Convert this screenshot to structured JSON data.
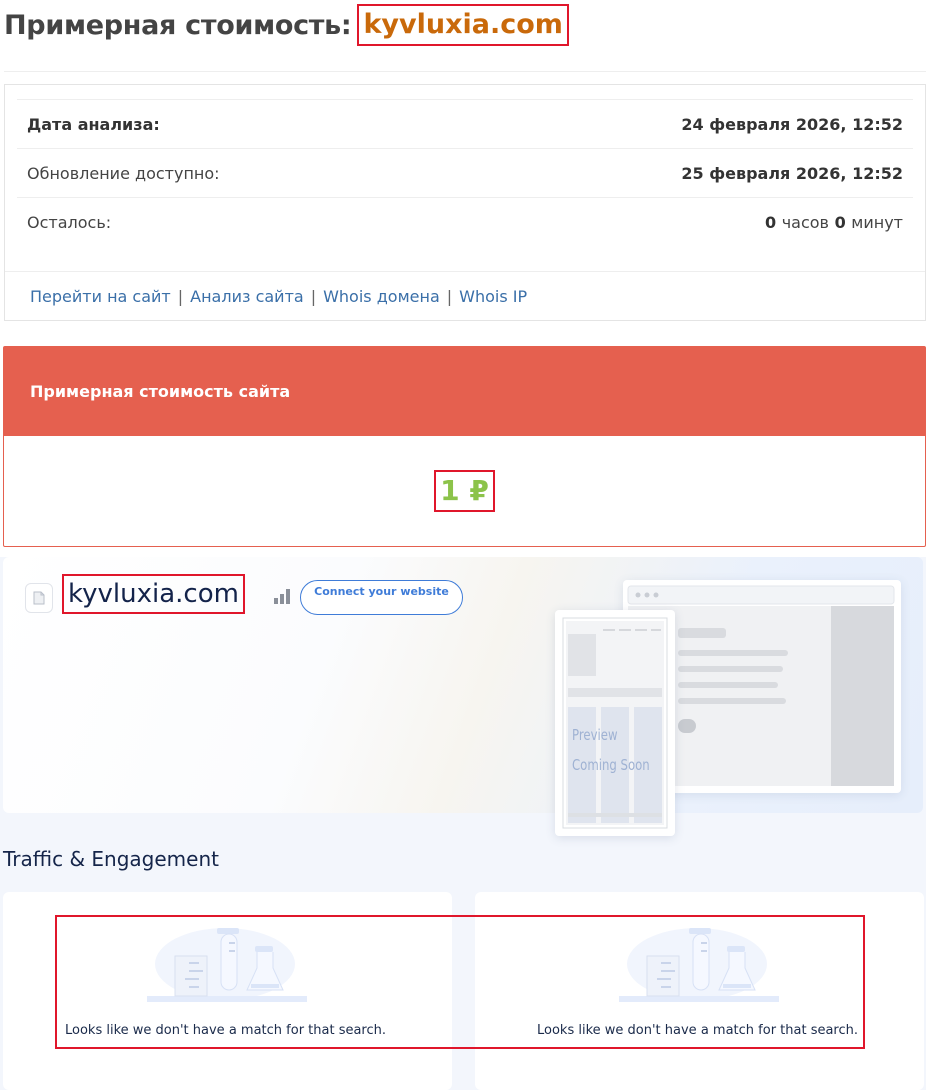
{
  "header": {
    "title": "Примерная стоимость:",
    "domain": "kyvluxia.com"
  },
  "info": {
    "rows": [
      {
        "label": "Дата анализа:",
        "value": "24 февраля 2026, 12:52"
      },
      {
        "label": "Обновление доступно:",
        "value": "25 февраля 2026, 12:52"
      },
      {
        "label": "Осталось:",
        "hours": "0",
        "hours_unit": "часов",
        "minutes": "0",
        "minutes_unit": "минут"
      }
    ],
    "links": [
      "Перейти на сайт",
      "Анализ сайта",
      "Whois домена",
      "Whois IP"
    ],
    "separator": "|"
  },
  "value_panel": {
    "heading": "Примерная стоимость сайта",
    "price": "1 ₽",
    "accent_color": "#e5604f",
    "price_color": "#8cc34a"
  },
  "similarweb": {
    "domain": "kyvluxia.com",
    "connect_button": "Connect your website",
    "preview_text_1": "Preview",
    "preview_text_2": "Coming Soon",
    "section_title": "Traffic & Engagement",
    "cards": [
      {
        "message": "Looks like we don't have a match for that search."
      },
      {
        "message": "Looks like we don't have a match for that search."
      }
    ]
  }
}
